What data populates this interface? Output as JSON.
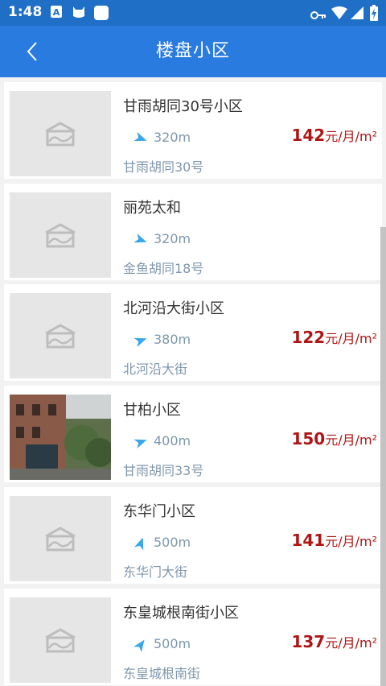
{
  "status_bar": {
    "time": "1:48"
  },
  "app_bar": {
    "title": "楼盘小区"
  },
  "communities": [
    {
      "name": "甘雨胡同30号小区",
      "distance": "320m",
      "price_value": "142",
      "price_unit": "元/月/m²",
      "address": "甘雨胡同30号",
      "has_photo": false,
      "arrow_angle": 20
    },
    {
      "name": "丽苑太和",
      "distance": "320m",
      "price_value": "",
      "price_unit": "",
      "address": "金鱼胡同18号",
      "has_photo": false,
      "arrow_angle": 20
    },
    {
      "name": "北河沿大街小区",
      "distance": "380m",
      "price_value": "122",
      "price_unit": "元/月/m²",
      "address": "北河沿大街",
      "has_photo": false,
      "arrow_angle": -20
    },
    {
      "name": "甘柏小区",
      "distance": "400m",
      "price_value": "150",
      "price_unit": "元/月/m²",
      "address": "甘雨胡同33号",
      "has_photo": true,
      "arrow_angle": -20
    },
    {
      "name": "东华门小区",
      "distance": "500m",
      "price_value": "141",
      "price_unit": "元/月/m²",
      "address": "东华门大街",
      "has_photo": false,
      "arrow_angle": -70
    },
    {
      "name": "东皇城根南街小区",
      "distance": "500m",
      "price_value": "137",
      "price_unit": "元/月/m²",
      "address": "东皇城根南街",
      "has_photo": false,
      "arrow_angle": -55
    }
  ]
}
